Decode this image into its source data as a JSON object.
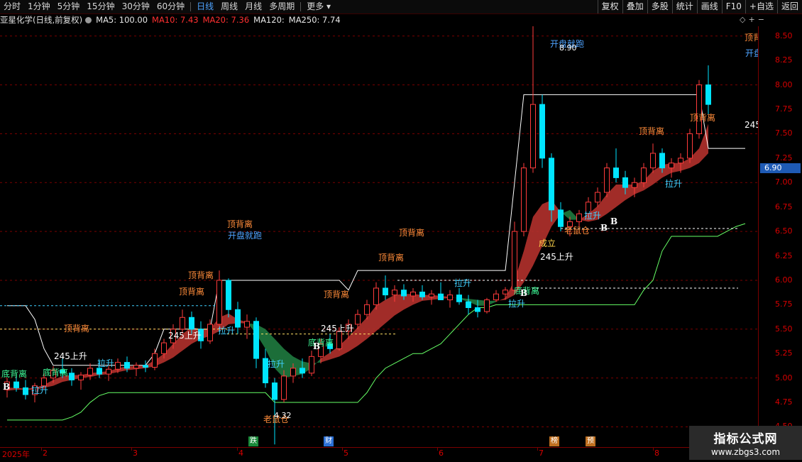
{
  "toolbar": {
    "periods": [
      "分时",
      "1分钟",
      "5分钟",
      "15分钟",
      "30分钟",
      "60分钟",
      "日线",
      "周线",
      "月线",
      "多周期",
      "更多"
    ],
    "active_period": "日线",
    "right_buttons": [
      "复权",
      "叠加",
      "多股",
      "统计",
      "画线",
      "F10",
      "+自选",
      "返回"
    ]
  },
  "info": {
    "title": "亚星化学(日线,前复权)",
    "ma5": "MA5: 100.00",
    "ma10": "MA10: 7.43",
    "ma20": "MA20: 7.36",
    "ma120": "MA120:",
    "ma250": "MA250: 7.74"
  },
  "price_axis": {
    "labels": [
      "8.50",
      "8.25",
      "8.00",
      "7.75",
      "7.50",
      "7.25",
      "7.00",
      "6.75",
      "6.50",
      "6.25",
      "6.00",
      "5.75",
      "5.50",
      "5.25",
      "5.00",
      "4.75",
      "4.50"
    ],
    "current_price": "6.90"
  },
  "date_axis": {
    "year": "2025年",
    "months": [
      "2",
      "3",
      "4",
      "5",
      "6",
      "7",
      "8"
    ]
  },
  "event_markers": [
    {
      "label": "跌",
      "color": "#1a8a3a"
    },
    {
      "label": "财",
      "color": "#2a6fd6"
    },
    {
      "label": "榜",
      "color": "#c07020"
    },
    {
      "label": "预",
      "color": "#c07020"
    }
  ],
  "annotations": {
    "top_divergence": "顶背离",
    "bottom_divergence": "底背离",
    "pull_up": "拉升",
    "open_run": "开盘就跑",
    "rise_245": "245上升",
    "old_rat": "老鼠仓",
    "established": "成立",
    "buy": "B",
    "high_price": "8.90",
    "low_price": "4.32"
  },
  "watermark": {
    "title": "指标公式网",
    "url": "www.zbgs3.com"
  },
  "colors": {
    "up": "#ff3b3b",
    "down": "#00e5ff",
    "grid": "#7a0000",
    "ribbon_up": "#b3312c",
    "ribbon_down": "#1f7a3f",
    "support_line": "#66ff66",
    "resist_line": "#ffffff"
  },
  "chart_data": {
    "type": "candlestick",
    "ylim": [
      4.3,
      8.6
    ],
    "candles": [
      {
        "o": 4.88,
        "h": 5.0,
        "l": 4.8,
        "c": 4.96
      },
      {
        "o": 4.96,
        "h": 5.02,
        "l": 4.86,
        "c": 4.9
      },
      {
        "o": 4.9,
        "h": 4.98,
        "l": 4.78,
        "c": 4.83
      },
      {
        "o": 4.83,
        "h": 4.95,
        "l": 4.75,
        "c": 4.92
      },
      {
        "o": 4.92,
        "h": 5.05,
        "l": 4.88,
        "c": 5.0
      },
      {
        "o": 5.0,
        "h": 5.12,
        "l": 4.95,
        "c": 5.08
      },
      {
        "o": 5.08,
        "h": 5.2,
        "l": 5.0,
        "c": 5.05
      },
      {
        "o": 5.05,
        "h": 5.1,
        "l": 4.92,
        "c": 4.98
      },
      {
        "o": 4.98,
        "h": 5.06,
        "l": 4.88,
        "c": 5.03
      },
      {
        "o": 5.03,
        "h": 5.15,
        "l": 4.98,
        "c": 5.1
      },
      {
        "o": 5.1,
        "h": 5.18,
        "l": 5.0,
        "c": 5.04
      },
      {
        "o": 5.04,
        "h": 5.12,
        "l": 4.97,
        "c": 5.09
      },
      {
        "o": 5.09,
        "h": 5.2,
        "l": 5.05,
        "c": 5.16
      },
      {
        "o": 5.16,
        "h": 5.22,
        "l": 5.06,
        "c": 5.1
      },
      {
        "o": 5.1,
        "h": 5.16,
        "l": 5.02,
        "c": 5.13
      },
      {
        "o": 5.13,
        "h": 5.18,
        "l": 5.06,
        "c": 5.11
      },
      {
        "o": 5.11,
        "h": 5.3,
        "l": 5.08,
        "c": 5.25
      },
      {
        "o": 5.25,
        "h": 5.4,
        "l": 5.2,
        "c": 5.36
      },
      {
        "o": 5.36,
        "h": 5.55,
        "l": 5.3,
        "c": 5.5
      },
      {
        "o": 5.5,
        "h": 5.7,
        "l": 5.45,
        "c": 5.62
      },
      {
        "o": 5.62,
        "h": 5.68,
        "l": 5.45,
        "c": 5.5
      },
      {
        "o": 5.5,
        "h": 5.58,
        "l": 5.3,
        "c": 5.38
      },
      {
        "o": 5.38,
        "h": 5.6,
        "l": 5.35,
        "c": 5.55
      },
      {
        "o": 5.55,
        "h": 6.1,
        "l": 5.5,
        "c": 6.0
      },
      {
        "o": 6.0,
        "h": 6.02,
        "l": 5.62,
        "c": 5.7
      },
      {
        "o": 5.7,
        "h": 5.78,
        "l": 5.45,
        "c": 5.52
      },
      {
        "o": 5.52,
        "h": 5.65,
        "l": 5.4,
        "c": 5.58
      },
      {
        "o": 5.58,
        "h": 5.62,
        "l": 5.1,
        "c": 5.2
      },
      {
        "o": 5.2,
        "h": 5.3,
        "l": 4.9,
        "c": 4.95
      },
      {
        "o": 4.95,
        "h": 5.0,
        "l": 4.32,
        "c": 4.78
      },
      {
        "o": 4.78,
        "h": 5.08,
        "l": 4.75,
        "c": 5.02
      },
      {
        "o": 5.02,
        "h": 5.15,
        "l": 4.95,
        "c": 5.1
      },
      {
        "o": 5.1,
        "h": 5.2,
        "l": 5.0,
        "c": 5.05
      },
      {
        "o": 5.05,
        "h": 5.28,
        "l": 5.02,
        "c": 5.22
      },
      {
        "o": 5.22,
        "h": 5.4,
        "l": 5.15,
        "c": 5.35
      },
      {
        "o": 5.35,
        "h": 5.45,
        "l": 5.25,
        "c": 5.3
      },
      {
        "o": 5.3,
        "h": 5.52,
        "l": 5.28,
        "c": 5.48
      },
      {
        "o": 5.48,
        "h": 5.6,
        "l": 5.4,
        "c": 5.55
      },
      {
        "o": 5.55,
        "h": 5.7,
        "l": 5.5,
        "c": 5.65
      },
      {
        "o": 5.65,
        "h": 5.8,
        "l": 5.6,
        "c": 5.75
      },
      {
        "o": 5.75,
        "h": 5.98,
        "l": 5.7,
        "c": 5.92
      },
      {
        "o": 5.92,
        "h": 6.05,
        "l": 5.8,
        "c": 5.85
      },
      {
        "o": 5.85,
        "h": 5.95,
        "l": 5.78,
        "c": 5.9
      },
      {
        "o": 5.9,
        "h": 5.96,
        "l": 5.8,
        "c": 5.84
      },
      {
        "o": 5.84,
        "h": 5.92,
        "l": 5.78,
        "c": 5.88
      },
      {
        "o": 5.88,
        "h": 5.95,
        "l": 5.8,
        "c": 5.83
      },
      {
        "o": 5.83,
        "h": 5.9,
        "l": 5.75,
        "c": 5.86
      },
      {
        "o": 5.86,
        "h": 5.98,
        "l": 5.8,
        "c": 5.8
      },
      {
        "o": 5.8,
        "h": 5.9,
        "l": 5.72,
        "c": 5.85
      },
      {
        "o": 5.85,
        "h": 5.92,
        "l": 5.75,
        "c": 5.78
      },
      {
        "o": 5.78,
        "h": 5.85,
        "l": 5.65,
        "c": 5.72
      },
      {
        "o": 5.72,
        "h": 5.8,
        "l": 5.62,
        "c": 5.68
      },
      {
        "o": 5.68,
        "h": 5.82,
        "l": 5.66,
        "c": 5.8
      },
      {
        "o": 5.8,
        "h": 5.9,
        "l": 5.78,
        "c": 5.86
      },
      {
        "o": 5.86,
        "h": 5.93,
        "l": 5.8,
        "c": 5.9
      },
      {
        "o": 5.9,
        "h": 6.6,
        "l": 5.88,
        "c": 6.5
      },
      {
        "o": 6.5,
        "h": 7.2,
        "l": 6.45,
        "c": 7.15
      },
      {
        "o": 7.15,
        "h": 8.9,
        "l": 7.1,
        "c": 7.8
      },
      {
        "o": 7.8,
        "h": 7.9,
        "l": 7.15,
        "c": 7.25
      },
      {
        "o": 7.25,
        "h": 7.3,
        "l": 6.6,
        "c": 6.72
      },
      {
        "o": 6.72,
        "h": 6.8,
        "l": 6.5,
        "c": 6.55
      },
      {
        "o": 6.55,
        "h": 6.65,
        "l": 6.45,
        "c": 6.6
      },
      {
        "o": 6.6,
        "h": 6.72,
        "l": 6.55,
        "c": 6.68
      },
      {
        "o": 6.68,
        "h": 6.85,
        "l": 6.62,
        "c": 6.8
      },
      {
        "o": 6.8,
        "h": 6.95,
        "l": 6.75,
        "c": 6.9
      },
      {
        "o": 6.9,
        "h": 7.2,
        "l": 6.85,
        "c": 7.15
      },
      {
        "o": 7.15,
        "h": 7.35,
        "l": 7.0,
        "c": 7.05
      },
      {
        "o": 7.05,
        "h": 7.12,
        "l": 6.88,
        "c": 6.95
      },
      {
        "o": 6.95,
        "h": 7.05,
        "l": 6.85,
        "c": 7.0
      },
      {
        "o": 7.0,
        "h": 7.2,
        "l": 6.95,
        "c": 7.15
      },
      {
        "o": 7.15,
        "h": 7.4,
        "l": 7.1,
        "c": 7.3
      },
      {
        "o": 7.3,
        "h": 7.35,
        "l": 7.1,
        "c": 7.15
      },
      {
        "o": 7.15,
        "h": 7.25,
        "l": 7.05,
        "c": 7.2
      },
      {
        "o": 7.2,
        "h": 7.3,
        "l": 7.1,
        "c": 7.25
      },
      {
        "o": 7.25,
        "h": 7.55,
        "l": 7.2,
        "c": 7.5
      },
      {
        "o": 7.5,
        "h": 8.05,
        "l": 7.45,
        "c": 8.0
      },
      {
        "o": 8.0,
        "h": 8.2,
        "l": 7.7,
        "c": 7.8
      }
    ],
    "support_line": [
      4.57,
      4.57,
      4.57,
      4.57,
      4.57,
      4.57,
      4.57,
      4.6,
      4.65,
      4.75,
      4.82,
      4.85,
      4.85,
      4.85,
      4.85,
      4.85,
      4.85,
      4.85,
      4.85,
      4.85,
      4.85,
      4.85,
      4.85,
      4.85,
      4.85,
      4.85,
      4.85,
      4.85,
      4.85,
      4.75,
      4.75,
      4.75,
      4.75,
      4.75,
      4.75,
      4.75,
      4.75,
      4.75,
      4.75,
      4.85,
      5.0,
      5.1,
      5.15,
      5.2,
      5.25,
      5.25,
      5.3,
      5.35,
      5.45,
      5.55,
      5.65,
      5.72,
      5.72,
      5.75,
      5.75,
      5.75,
      5.75,
      5.75,
      5.75,
      5.75,
      5.75,
      5.75,
      5.75,
      5.75,
      5.75,
      5.75,
      5.75,
      5.75,
      5.75,
      5.9,
      6.0,
      6.3,
      6.45,
      6.45,
      6.45,
      6.45,
      6.45,
      6.45,
      6.5,
      6.55,
      6.58
    ],
    "resist_line": [
      5.74,
      5.74,
      5.74,
      5.6,
      5.3,
      5.13,
      5.13,
      5.13,
      5.13,
      5.13,
      5.13,
      5.13,
      5.13,
      5.13,
      5.13,
      5.13,
      5.25,
      5.5,
      5.5,
      5.5,
      5.5,
      5.5,
      5.5,
      6.0,
      6.0,
      6.0,
      6.0,
      6.0,
      6.0,
      6.0,
      6.0,
      6.0,
      6.0,
      6.0,
      6.0,
      6.0,
      6.0,
      5.9,
      6.1,
      6.1,
      6.1,
      6.1,
      6.1,
      6.1,
      6.1,
      6.1,
      6.1,
      6.1,
      6.1,
      6.1,
      6.1,
      6.1,
      6.1,
      6.1,
      6.1,
      7.0,
      7.9,
      7.9,
      7.9,
      7.9,
      7.9,
      7.9,
      7.9,
      7.9,
      7.9,
      7.9,
      7.9,
      7.9,
      7.9,
      7.9,
      7.9,
      7.9,
      7.9,
      7.9,
      7.9,
      7.9,
      7.35,
      7.35,
      7.35,
      7.35,
      7.35
    ],
    "ribbon_fast": [
      4.9,
      4.9,
      4.89,
      4.9,
      4.93,
      4.98,
      5.02,
      5.03,
      5.03,
      5.05,
      5.06,
      5.07,
      5.1,
      5.12,
      5.12,
      5.13,
      5.18,
      5.25,
      5.35,
      5.45,
      5.52,
      5.5,
      5.5,
      5.62,
      5.66,
      5.6,
      5.57,
      5.45,
      5.3,
      5.1,
      5.0,
      5.02,
      5.04,
      5.1,
      5.2,
      5.26,
      5.33,
      5.42,
      5.52,
      5.62,
      5.74,
      5.8,
      5.85,
      5.86,
      5.86,
      5.85,
      5.85,
      5.84,
      5.83,
      5.81,
      5.78,
      5.74,
      5.74,
      5.78,
      5.82,
      6.0,
      6.3,
      6.65,
      6.78,
      6.82,
      6.7,
      6.62,
      6.62,
      6.68,
      6.76,
      6.88,
      6.98,
      6.98,
      6.98,
      7.02,
      7.12,
      7.18,
      7.2,
      7.2,
      7.25,
      7.35,
      7.6
    ],
    "ribbon_slow": [
      4.87,
      4.88,
      4.88,
      4.88,
      4.9,
      4.92,
      4.96,
      4.98,
      5.0,
      5.01,
      5.03,
      5.04,
      5.06,
      5.08,
      5.09,
      5.1,
      5.12,
      5.16,
      5.21,
      5.28,
      5.35,
      5.4,
      5.43,
      5.48,
      5.55,
      5.56,
      5.56,
      5.55,
      5.5,
      5.4,
      5.3,
      5.22,
      5.17,
      5.15,
      5.16,
      5.19,
      5.22,
      5.27,
      5.33,
      5.4,
      5.48,
      5.56,
      5.64,
      5.7,
      5.75,
      5.79,
      5.8,
      5.81,
      5.82,
      5.82,
      5.81,
      5.8,
      5.79,
      5.79,
      5.8,
      5.85,
      5.98,
      6.15,
      6.35,
      6.55,
      6.68,
      6.72,
      6.62,
      6.6,
      6.62,
      6.68,
      6.75,
      6.82,
      6.88,
      6.92,
      6.98,
      7.05,
      7.1,
      7.12,
      7.15,
      7.2,
      7.3
    ]
  }
}
